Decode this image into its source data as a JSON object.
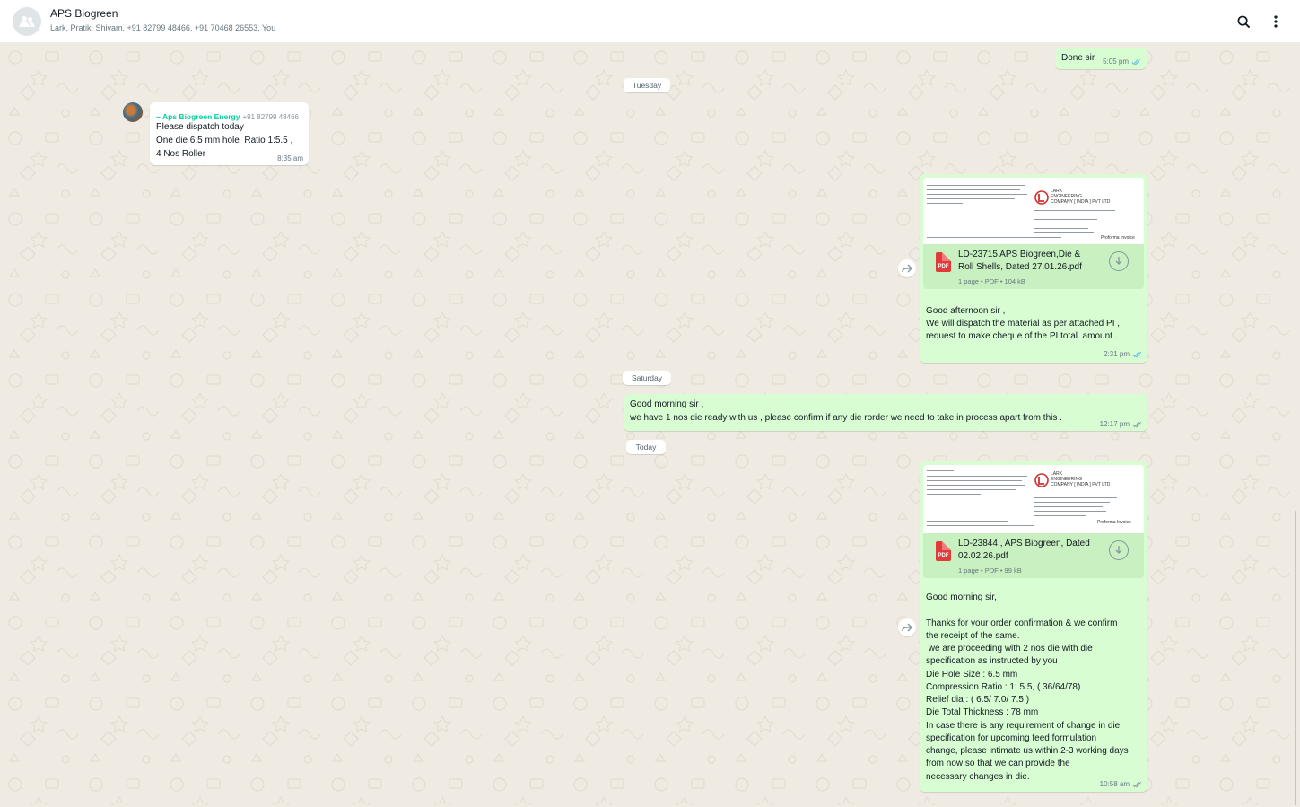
{
  "header": {
    "title": "APS Biogreen",
    "participants": "Lark, Pratik, Shivam, +91 82799 48466, +91 70468 26553, You"
  },
  "days": {
    "tuesday": "Tuesday",
    "saturday": "Saturday",
    "today": "Today"
  },
  "messages": {
    "m0": {
      "text": "Done sir",
      "time": "5:05 pm"
    },
    "m1": {
      "sender": "~ Aps Biogreen Energy",
      "phone": "+91 82799 48466",
      "lines": [
        "Please dispatch today",
        "One die 6.5 mm hole  Ratio 1:5.5 ,",
        "4 Nos Roller"
      ],
      "time": "8:35 am"
    },
    "m2": {
      "doc_title_lines": [
        "LD-23715 APS Biogreen,Die &",
        "Roll Shells, Dated 27.01.26.pdf"
      ],
      "doc_meta": "1 page • PDF • 104 kB",
      "pdf_label": "PDF",
      "preview": {
        "company": "LARK",
        "company_line2": "ENGINEERING",
        "company_line3": "COMPANY [ INDIA ] PVT LTD",
        "doc_type": "Proforma Invoice"
      },
      "lines": [
        "Good afternoon sir ,",
        "We will dispatch the material as per attached PI ,",
        "request to make cheque of the PI total  amount ."
      ],
      "time": "2:31 pm"
    },
    "m3": {
      "lines": [
        "Good morning sir ,",
        "we have 1 nos die ready with us , please confirm if any die rorder we need to take in process apart from this ."
      ],
      "time": "12:17 pm"
    },
    "m4": {
      "doc_title_lines": [
        "LD-23844 , APS Biogreen, Dated",
        "02.02.26.pdf"
      ],
      "doc_meta": "1 page • PDF • 99 kB",
      "pdf_label": "PDF",
      "preview": {
        "company": "LARK",
        "company_line2": "ENGINEERING",
        "company_line3": "COMPANY [ INDIA ] PVT LTD",
        "doc_type": "Proforma Invoice"
      },
      "lines": [
        "Good morning sir,",
        "",
        "Thanks for your order confirmation & we confirm",
        "the receipt of the same.",
        " we are proceeding with 2 nos die with die",
        "specification as instructed by you",
        "Die Hole Size : 6.5 mm",
        "Compression Ratio : 1: 5.5, ( 36/64/78)",
        "Relief dia : ( 6.5/ 7.0/ 7.5 )",
        "Die Total Thickness : 78 mm",
        "In case there is any requirement of change in die",
        "specification for upcoming feed formulation",
        "change, please intimate us within 2-3 working days",
        "from now so that we can provide the",
        "necessary changes in die."
      ],
      "time": "10:58 am"
    }
  },
  "colors": {
    "outgoing_bubble": "#d9fdd3",
    "incoming_bubble": "#ffffff",
    "read_tick": "#53bdeb",
    "sender_name": "#06cf9c",
    "chat_background": "#efeae2"
  }
}
